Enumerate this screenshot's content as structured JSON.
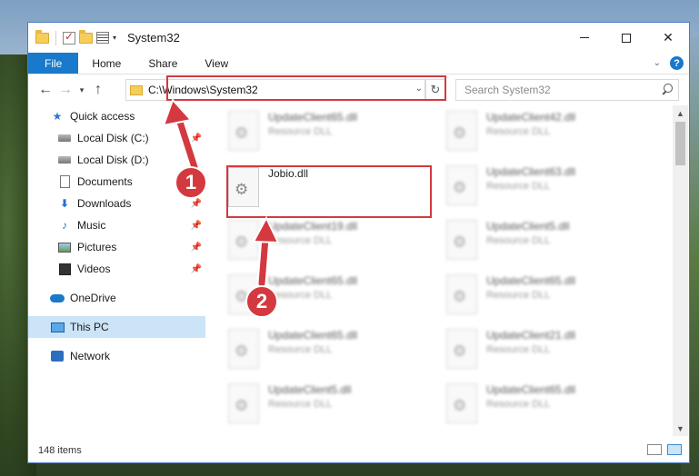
{
  "window": {
    "title": "System32",
    "minimize_glyph": "",
    "maximize_glyph": "",
    "close_glyph": "✕"
  },
  "ribbon": {
    "tabs": [
      {
        "label": "File"
      },
      {
        "label": "Home"
      },
      {
        "label": "Share"
      },
      {
        "label": "View"
      }
    ],
    "help_glyph": "?",
    "collapse_glyph": "⌄"
  },
  "address": {
    "path": "C:\\Windows\\System32",
    "search_placeholder": "Search System32"
  },
  "nav": {
    "quick_access": "Quick access",
    "items": [
      {
        "label": "Local Disk (C:)",
        "icon": "drive-icon",
        "pinned": true
      },
      {
        "label": "Local Disk (D:)",
        "icon": "drive-icon",
        "pinned": false
      },
      {
        "label": "Documents",
        "icon": "documents-icon",
        "pinned": true
      },
      {
        "label": "Downloads",
        "icon": "downloads-icon",
        "pinned": true
      },
      {
        "label": "Music",
        "icon": "music-icon",
        "pinned": true
      },
      {
        "label": "Pictures",
        "icon": "pictures-icon",
        "pinned": true
      },
      {
        "label": "Videos",
        "icon": "videos-icon",
        "pinned": true
      }
    ],
    "onedrive": "OneDrive",
    "this_pc": "This PC",
    "network": "Network"
  },
  "files": {
    "left_column": [
      {
        "name": "UpdateClient65.dll",
        "type": "Resource DLL"
      },
      {
        "name": "Jobio.dll",
        "type": ""
      },
      {
        "name": "UpdateClient19.dll",
        "type": "Resource DLL"
      },
      {
        "name": "UpdateClient65.dll",
        "type": "Resource DLL"
      },
      {
        "name": "UpdateClient65.dll",
        "type": "Resource DLL"
      },
      {
        "name": "UpdateClient5.dll",
        "type": "Resource DLL"
      }
    ],
    "right_column": [
      {
        "name": "UpdateClient42.dll",
        "type": "Resource DLL"
      },
      {
        "name": "UpdateClient63.dll",
        "type": "Resource DLL"
      },
      {
        "name": "UpdateClient5.dll",
        "type": "Resource DLL"
      },
      {
        "name": "UpdateClient65.dll",
        "type": "Resource DLL"
      },
      {
        "name": "UpdateClient21.dll",
        "type": "Resource DLL"
      },
      {
        "name": "UpdateClient65.dll",
        "type": "Resource DLL"
      }
    ]
  },
  "status": {
    "item_count": "148 items"
  },
  "annotations": {
    "step1": "1",
    "step2": "2",
    "accent_color": "#d3393f"
  },
  "colors": {
    "file_tab": "#1979ca",
    "selection": "#cce4f7"
  }
}
